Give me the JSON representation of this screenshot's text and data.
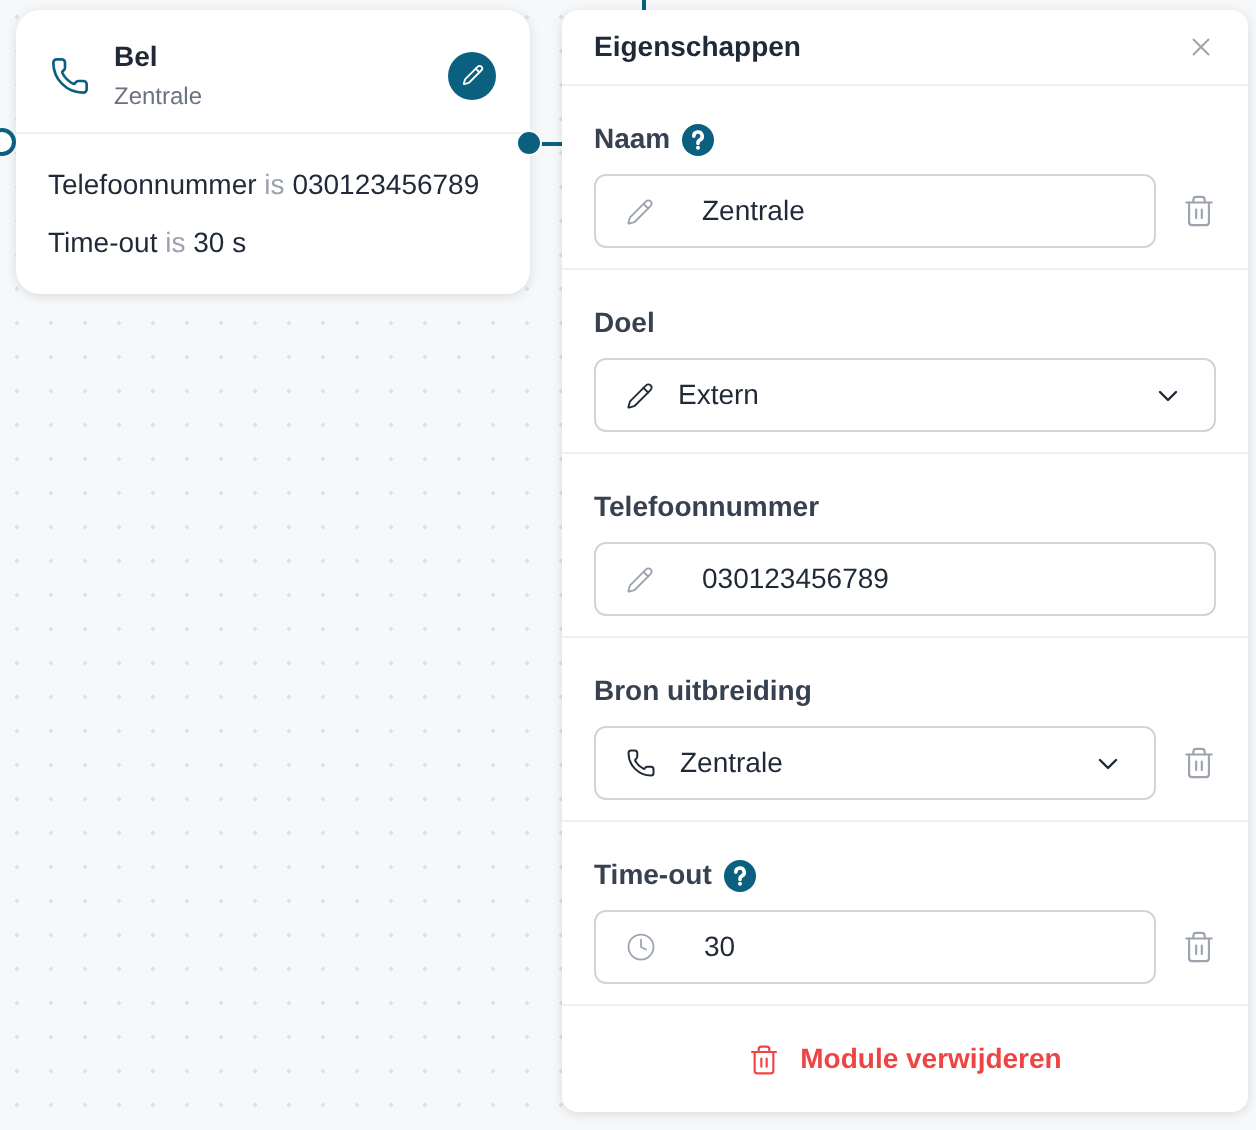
{
  "node": {
    "title": "Bel",
    "subtitle": "Zentrale",
    "lines": [
      {
        "label": "Telefoonnummer",
        "connector": "is",
        "value": "030123456789"
      },
      {
        "label": "Time-out",
        "connector": "is",
        "value": "30 s"
      }
    ]
  },
  "panel": {
    "title": "Eigenschappen",
    "fields": [
      {
        "label": "Naam",
        "help": true,
        "kind": "text",
        "value": "Zentrale",
        "deletable": true
      },
      {
        "label": "Doel",
        "help": false,
        "kind": "select",
        "value": "Extern",
        "deletable": false
      },
      {
        "label": "Telefoonnummer",
        "help": false,
        "kind": "text",
        "value": "030123456789",
        "deletable": false
      },
      {
        "label": "Bron uitbreiding",
        "help": false,
        "kind": "select",
        "value": "Zentrale",
        "deletable": true
      },
      {
        "label": "Time-out",
        "help": true,
        "kind": "text",
        "value": "30",
        "deletable": true
      }
    ],
    "delete_button": "Module verwijderen"
  }
}
